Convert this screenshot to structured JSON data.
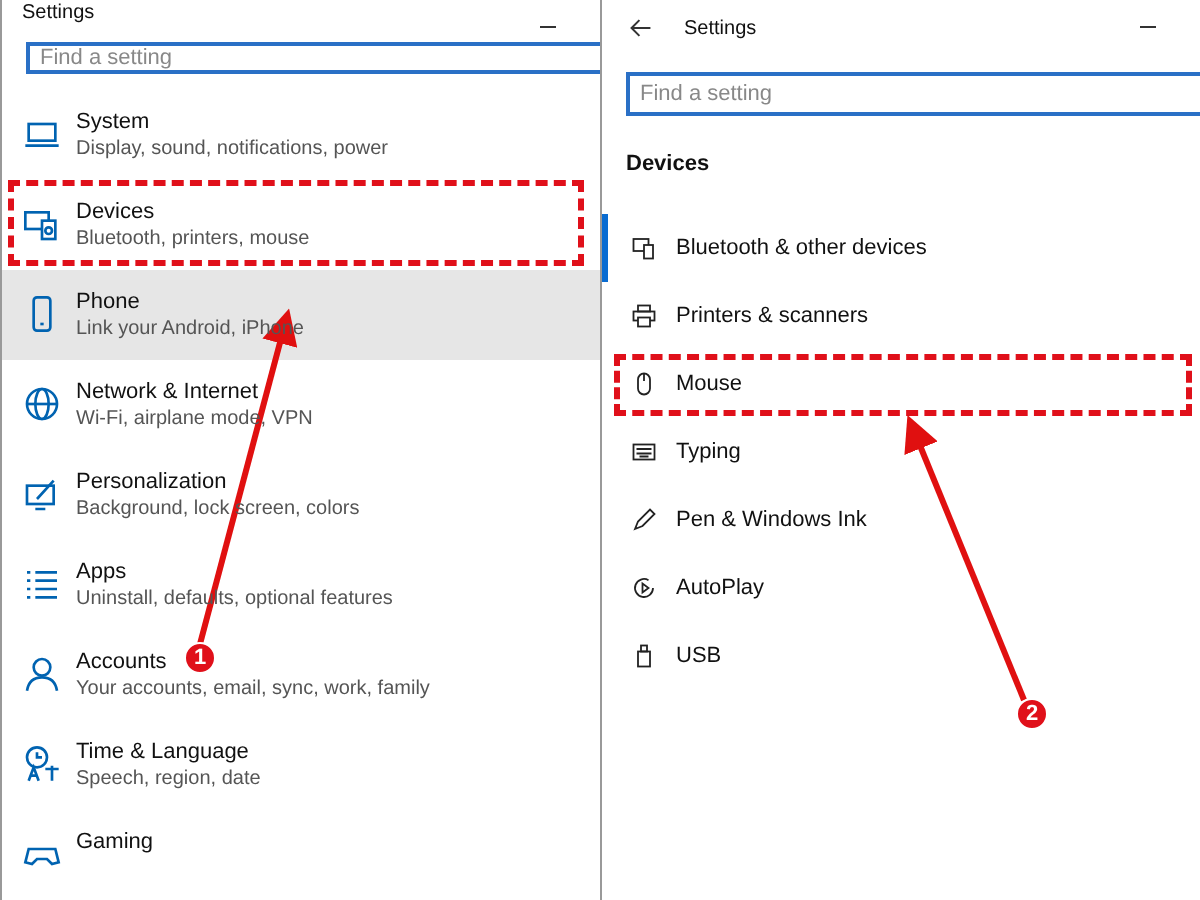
{
  "left_window": {
    "title": "Settings",
    "search": {
      "placeholder": "Find a setting"
    },
    "categories": [
      {
        "title": "System",
        "subtitle": "Display, sound, notifications, power",
        "highlighted": false,
        "outlined": false
      },
      {
        "title": "Devices",
        "subtitle": "Bluetooth, printers, mouse",
        "highlighted": false,
        "outlined": true
      },
      {
        "title": "Phone",
        "subtitle": "Link your Android, iPhone",
        "highlighted": true,
        "outlined": false
      },
      {
        "title": "Network & Internet",
        "subtitle": "Wi-Fi, airplane mode, VPN",
        "highlighted": false,
        "outlined": false
      },
      {
        "title": "Personalization",
        "subtitle": "Background, lock screen, colors",
        "highlighted": false,
        "outlined": false
      },
      {
        "title": "Apps",
        "subtitle": "Uninstall, defaults, optional features",
        "highlighted": false,
        "outlined": false
      },
      {
        "title": "Accounts",
        "subtitle": "Your accounts, email, sync, work, family",
        "highlighted": false,
        "outlined": false
      },
      {
        "title": "Time & Language",
        "subtitle": "Speech, region, date",
        "highlighted": false,
        "outlined": false
      },
      {
        "title": "Gaming",
        "highlighted": false,
        "outlined": false
      }
    ]
  },
  "right_window": {
    "title": "Settings",
    "search": {
      "placeholder": "Find a setting"
    },
    "heading": "Devices",
    "items": [
      {
        "label": "Bluetooth & other devices",
        "selected": true,
        "outlined": false
      },
      {
        "label": "Printers & scanners",
        "selected": false,
        "outlined": false
      },
      {
        "label": "Mouse",
        "selected": false,
        "outlined": true
      },
      {
        "label": "Typing",
        "selected": false,
        "outlined": false
      },
      {
        "label": "Pen & Windows Ink",
        "selected": false,
        "outlined": false
      },
      {
        "label": "AutoPlay",
        "selected": false,
        "outlined": false
      },
      {
        "label": "USB",
        "selected": false,
        "outlined": false
      }
    ]
  },
  "annotations": [
    {
      "label": "1"
    },
    {
      "label": "2"
    }
  ]
}
